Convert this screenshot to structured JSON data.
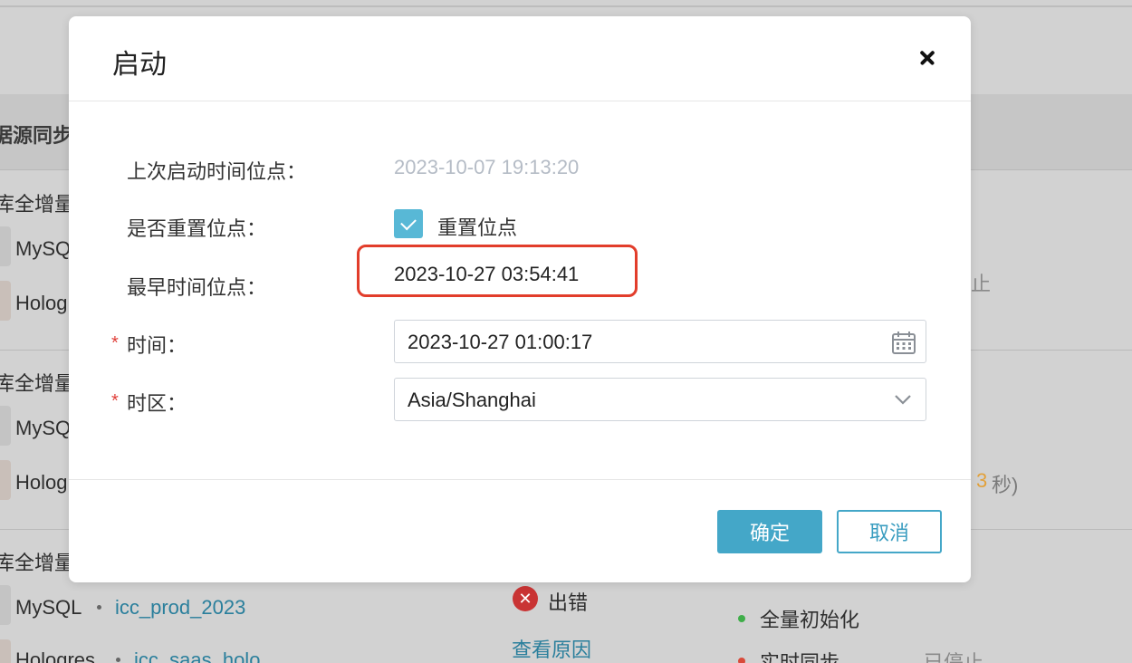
{
  "background": {
    "header_text": "据源同步",
    "sections": [
      {
        "title": "库全增量",
        "source": "MySQ",
        "target": "Holog"
      },
      {
        "title": "库全增量",
        "source": "MySQ",
        "target": "Holog"
      },
      {
        "title": "库全增量",
        "source": "MySQL",
        "target": "Hologres"
      }
    ],
    "right_text_1": "止",
    "right_text_2_prefix": "",
    "right_text_2_number": "3",
    "right_text_2_suffix": "秒)",
    "row3_source_db": "icc_prod_2023",
    "row3_target_db": "icc_saas_holo",
    "error_status": "出错",
    "view_reason_link": "查看原因",
    "stage_full_init": "全量初始化",
    "stage_realtime": "实时同步",
    "stage_realtime_status": "已停止",
    "colors": {
      "link": "#2a7f9c",
      "number_accent": "#e2a13b",
      "success_dot": "#3fae49",
      "error_dot": "#d94a3a"
    }
  },
  "modal": {
    "title": "启动",
    "fields": {
      "last_start_label": "上次启动时间位点：",
      "last_start_value": "2023-10-07 19:13:20",
      "reset_label": "是否重置位点：",
      "reset_checkbox_label": "重置位点",
      "reset_checked": true,
      "earliest_label": "最早时间位点：",
      "earliest_value": "2023-10-27 03:54:41",
      "time_label": "时间：",
      "time_value": "2023-10-27 01:00:17",
      "timezone_label": "时区：",
      "timezone_value": "Asia/Shanghai",
      "required_mark": "*"
    },
    "buttons": {
      "confirm": "确定",
      "cancel": "取消"
    },
    "colors": {
      "primary": "#44a7c8",
      "highlight_border": "#e23d2b",
      "required": "#e0403a"
    }
  }
}
